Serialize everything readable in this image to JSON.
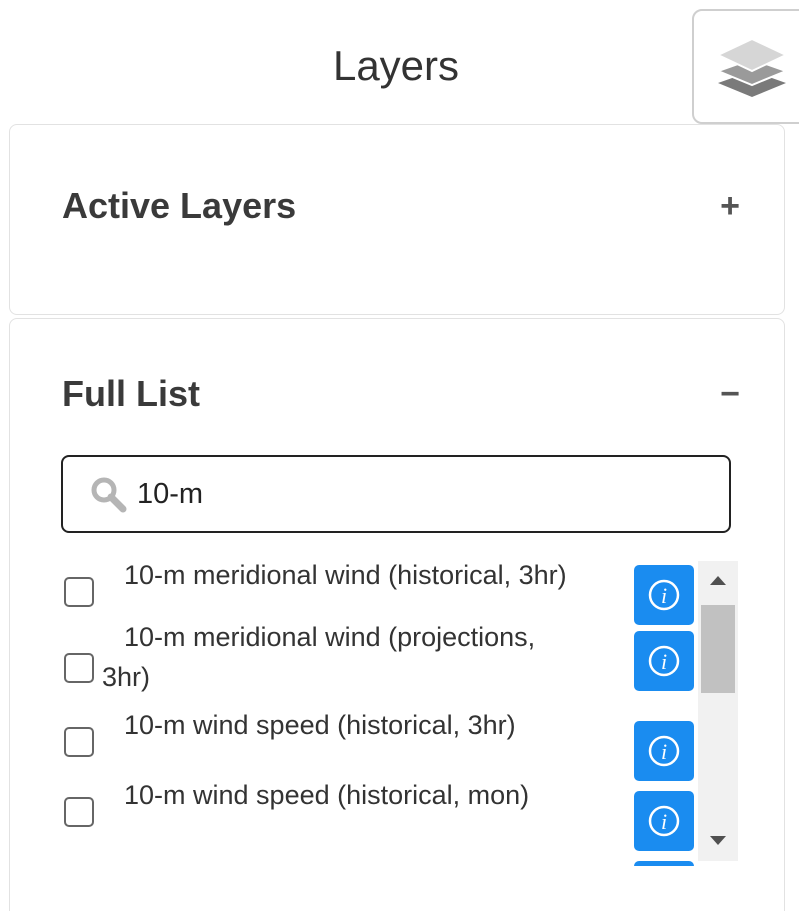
{
  "panel": {
    "title": "Layers"
  },
  "active_layers": {
    "title": "Active Layers",
    "toggle": "+"
  },
  "full_list": {
    "title": "Full List",
    "toggle": "−",
    "search": {
      "value": "10-m",
      "placeholder": ""
    },
    "items": [
      {
        "label": "10-m meridional wind (historical, 3hr)",
        "checked": false
      },
      {
        "label_line1": "10-m meridional wind (projections,",
        "label_line2": "3hr)",
        "checked": false
      },
      {
        "label": "10-m wind speed (historical, 3hr)",
        "checked": false
      },
      {
        "label": "10-m wind speed (historical, mon)",
        "checked": false
      }
    ]
  },
  "icons": {
    "layers_toggle": "layers-stack-icon",
    "search": "magnifier-icon",
    "info": "info-circle-icon"
  },
  "colors": {
    "info_button": "#1a8cf0",
    "text": "#333333"
  }
}
